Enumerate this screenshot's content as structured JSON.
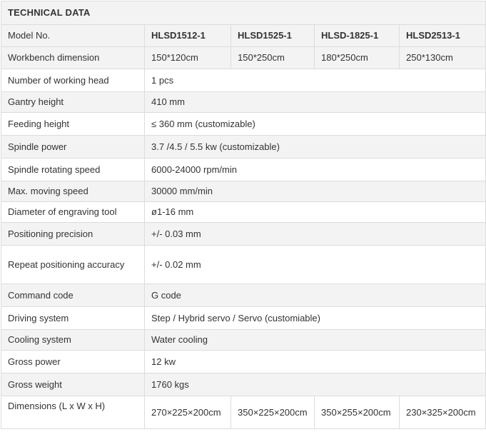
{
  "title": "TECHNICAL  DATA",
  "header": {
    "label": "Model No.",
    "models": [
      "HLSD1512-1",
      "HLSD1525-1",
      "HLSD-1825-1",
      "HLSD2513-1"
    ]
  },
  "workbench": {
    "label": "Workbench dimension",
    "values": [
      "150*120cm",
      "150*250cm",
      "180*250cm",
      "250*130cm"
    ]
  },
  "rows": [
    {
      "label": "Number of working head",
      "value": "1 pcs"
    },
    {
      "label": "Gantry height",
      "value": "410 mm"
    },
    {
      "label": "Feeding height",
      "value": "≤ 360 mm  (customizable)"
    },
    {
      "label": "Spindle power",
      "value": "3.7 /4.5 / 5.5 kw (customizable)"
    },
    {
      "label": "Spindle rotating speed",
      "value": "6000-24000 rpm/min"
    },
    {
      "label": "Max. moving speed",
      "value": "30000 mm/min"
    },
    {
      "label": "Diameter of engraving tool",
      "value": "ø1-16 mm"
    },
    {
      "label": "Positioning precision",
      "value": "+/- 0.03 mm"
    },
    {
      "label": "Repeat positioning accuracy",
      "value": "+/- 0.02 mm"
    },
    {
      "label": "Command code",
      "value": "G code"
    },
    {
      "label": "Driving system",
      "value": "Step / Hybrid servo / Servo (customiable)"
    },
    {
      "label": "Cooling system",
      "value": "Water cooling"
    },
    {
      "label": "Gross power",
      "value": "12 kw"
    },
    {
      "label": "Gross weight",
      "value": "1760 kgs"
    }
  ],
  "dimensions": {
    "label": "Dimensions (L x W x H)",
    "values": [
      "270×225×200cm",
      "350×225×200cm",
      "350×255×200cm",
      "230×325×200cm"
    ]
  }
}
